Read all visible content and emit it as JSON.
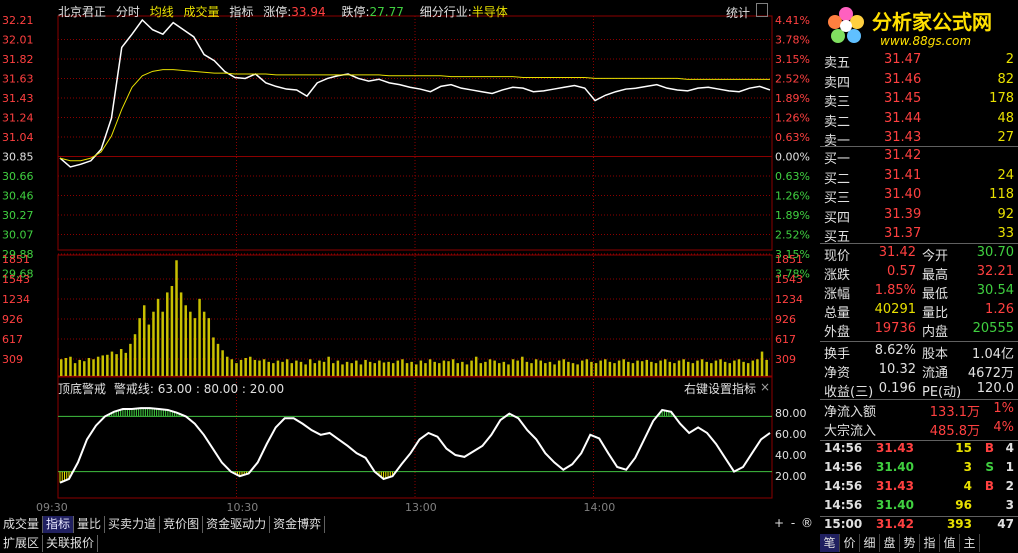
{
  "header": {
    "stock_name": "北京君正",
    "tab_time": "分时",
    "tab_avg": "均线",
    "tab_vol": "成交量",
    "tab_ind": "指标",
    "limit_up_label": "涨停:",
    "limit_up_value": "33.94",
    "limit_down_label": "跌停:",
    "limit_down_value": "27.77",
    "industry_label": "细分行业:",
    "industry_value": "半导体",
    "stat_button": "统计"
  },
  "axes": {
    "price_labels": [
      "32.21",
      "32.01",
      "31.82",
      "31.63",
      "31.43",
      "31.24",
      "31.04",
      "30.85",
      "30.66",
      "30.46",
      "30.27",
      "30.07",
      "29.88",
      "29.68"
    ],
    "pct_labels": [
      "4.41%",
      "3.78%",
      "3.15%",
      "2.52%",
      "1.89%",
      "1.26%",
      "0.63%",
      "0.00%",
      "0.63%",
      "1.26%",
      "1.89%",
      "2.52%",
      "3.15%",
      "3.78%"
    ],
    "vol_labels": [
      "1851",
      "1543",
      "1234",
      "926",
      "617",
      "309"
    ],
    "ind_labels": [
      "80.00",
      "60.00",
      "40.00",
      "20.00"
    ],
    "time_labels": [
      "09:30",
      "10:30",
      "13:00",
      "14:00"
    ]
  },
  "indicator": {
    "name": "顶底警戒",
    "param_text": "警戒线: 63.00 : 80.00 : 20.00",
    "right_text": "右键设置指标",
    "close": "×"
  },
  "chart_data": [
    {
      "type": "line",
      "name_price": "price",
      "ylim": [
        29.68,
        32.21
      ],
      "prev_close": 30.85,
      "price": [
        30.65,
        30.55,
        30.58,
        30.62,
        30.75,
        31.1,
        31.9,
        32.05,
        32.21,
        32.1,
        32.05,
        32.18,
        32.1,
        32.02,
        31.82,
        31.75,
        31.63,
        31.56,
        31.55,
        31.6,
        31.5,
        31.46,
        31.43,
        31.42,
        31.35,
        31.5,
        31.55,
        31.58,
        31.6,
        31.55,
        31.52,
        31.54,
        31.5,
        31.48,
        31.45,
        31.43,
        31.4,
        31.46,
        31.48,
        31.44,
        31.42,
        31.4,
        31.38,
        31.42,
        31.45,
        31.44,
        31.4,
        31.41,
        31.43,
        31.45,
        31.47,
        31.44,
        31.3,
        31.36,
        31.4,
        31.43,
        31.44,
        31.46,
        31.48,
        31.44,
        31.42,
        31.41,
        31.44,
        31.45,
        31.43,
        31.41,
        31.4,
        31.44,
        31.46,
        31.42
      ],
      "avg": [
        30.65,
        30.62,
        30.62,
        30.65,
        30.72,
        30.9,
        31.2,
        31.45,
        31.58,
        31.63,
        31.65,
        31.65,
        31.64,
        31.63,
        31.62,
        31.61,
        31.61,
        31.6,
        31.6,
        31.6,
        31.6,
        31.59,
        31.59,
        31.59,
        31.59,
        31.59,
        31.59,
        31.59,
        31.59,
        31.59,
        31.59,
        31.59,
        31.58,
        31.58,
        31.58,
        31.58,
        31.58,
        31.58,
        31.57,
        31.57,
        31.57,
        31.57,
        31.57,
        31.57,
        31.57,
        31.56,
        31.56,
        31.56,
        31.56,
        31.56,
        31.56,
        31.56,
        31.55,
        31.55,
        31.55,
        31.55,
        31.55,
        31.55,
        31.55,
        31.55,
        31.55,
        31.54,
        31.54,
        31.54,
        31.54,
        31.54,
        31.54,
        31.54,
        31.54,
        31.54
      ]
    },
    {
      "type": "bar",
      "ylim": [
        0,
        1851
      ],
      "values": [
        260,
        280,
        300,
        200,
        250,
        230,
        280,
        260,
        300,
        320,
        330,
        380,
        340,
        420,
        360,
        500,
        650,
        900,
        1100,
        800,
        1000,
        1200,
        1000,
        1300,
        1400,
        1800,
        1300,
        1100,
        1000,
        900,
        1200,
        1000,
        900,
        600,
        500,
        400,
        300,
        260,
        200,
        250,
        280,
        300,
        250,
        240,
        260,
        220,
        200,
        240,
        220,
        260,
        200,
        240,
        220,
        180,
        260,
        200,
        240,
        220,
        300,
        200,
        240,
        180,
        220,
        200,
        240,
        180,
        250,
        220,
        200,
        240,
        210,
        220,
        200,
        240,
        260,
        200,
        220,
        180,
        240,
        200,
        260,
        220,
        200,
        240,
        230,
        260,
        200,
        220,
        180,
        240,
        300,
        200,
        220,
        260,
        240,
        200,
        220,
        180,
        260,
        240,
        300,
        220,
        200,
        260,
        240,
        200,
        220,
        180,
        240,
        260,
        220,
        200,
        180,
        240,
        260,
        220,
        200,
        240,
        260,
        220,
        200,
        240,
        260,
        220,
        200,
        240,
        230,
        250,
        220,
        200,
        240,
        260,
        220,
        200,
        240,
        260,
        220,
        200,
        240,
        260,
        220,
        200,
        240,
        260,
        220,
        200,
        240,
        260,
        220,
        200,
        240,
        260,
        380,
        250
      ]
    },
    {
      "type": "line",
      "name_ind": "顶底警戒",
      "ylim": [
        0,
        100
      ],
      "lines": [
        80,
        20
      ],
      "values": [
        8,
        12,
        30,
        55,
        70,
        80,
        85,
        88,
        88,
        89,
        89,
        88,
        87,
        84,
        80,
        72,
        60,
        45,
        30,
        20,
        15,
        18,
        30,
        50,
        68,
        78,
        78,
        72,
        65,
        60,
        62,
        55,
        48,
        40,
        35,
        20,
        12,
        15,
        28,
        40,
        55,
        62,
        58,
        45,
        38,
        36,
        42,
        48,
        60,
        76,
        83,
        78,
        65,
        55,
        40,
        30,
        22,
        28,
        40,
        60,
        56,
        40,
        25,
        22,
        35,
        55,
        75,
        87,
        85,
        72,
        62,
        68,
        62,
        50,
        35,
        20,
        25,
        40,
        55,
        62
      ]
    }
  ],
  "order_book": {
    "sell": [
      {
        "label": "卖五",
        "price": "31.47",
        "vol": "2"
      },
      {
        "label": "卖四",
        "price": "31.46",
        "vol": "82"
      },
      {
        "label": "卖三",
        "price": "31.45",
        "vol": "178"
      },
      {
        "label": "卖二",
        "price": "31.44",
        "vol": "48"
      },
      {
        "label": "卖一",
        "price": "31.43",
        "vol": "27"
      }
    ],
    "buy": [
      {
        "label": "买一",
        "price": "31.42",
        "vol": ""
      },
      {
        "label": "买二",
        "price": "31.41",
        "vol": "24"
      },
      {
        "label": "买三",
        "price": "31.40",
        "vol": "118"
      },
      {
        "label": "买四",
        "price": "31.39",
        "vol": "92"
      },
      {
        "label": "买五",
        "price": "31.37",
        "vol": "33"
      }
    ]
  },
  "quote": {
    "now_label": "现价",
    "now": "31.42",
    "open_label": "今开",
    "open": "30.70",
    "chg_label": "涨跌",
    "chg": "0.57",
    "high_label": "最高",
    "high": "32.21",
    "pct_label": "涨幅",
    "pct": "1.85%",
    "low_label": "最低",
    "low": "30.54",
    "vol_label": "总量",
    "vol": "40291",
    "vr_label": "量比",
    "vr": "1.26",
    "out_label": "外盘",
    "out": "19736",
    "in_label": "内盘",
    "in": "20555",
    "turn_label": "换手",
    "turn": "8.62%",
    "cap_label": "股本",
    "cap": "1.04亿",
    "nav_label": "净资",
    "nav": "10.32",
    "float_label": "流通",
    "float": "4672万",
    "eps_label": "收益(三)",
    "eps": "0.196",
    "pe_label": "PE(动)",
    "pe": "120.0",
    "net_label": "净流入额",
    "net": "133.1万",
    "net_pct": "1%",
    "big_label": "大宗流入",
    "big": "485.8万",
    "big_pct": "4%"
  },
  "ticks": [
    {
      "time": "14:56",
      "price": "31.43",
      "vol": "15",
      "side": "B",
      "num": "4"
    },
    {
      "time": "14:56",
      "price": "31.40",
      "vol": "3",
      "side": "S",
      "num": "1"
    },
    {
      "time": "14:56",
      "price": "31.43",
      "vol": "4",
      "side": "B",
      "num": "2"
    },
    {
      "time": "14:56",
      "price": "31.40",
      "vol": "96",
      "side": "",
      "num": "3"
    },
    {
      "time": "15:00",
      "price": "31.42",
      "vol": "393",
      "side": "",
      "num": "47"
    }
  ],
  "bottom_tabs": [
    "成交量",
    "指标",
    "量比",
    "买卖力道",
    "竞价图",
    "资金驱动力",
    "资金博弈"
  ],
  "bottom_tabs2": [
    "扩展区",
    "关联报价"
  ],
  "zoom_buttons": [
    "+",
    "-",
    "®"
  ],
  "right_tabs": [
    "笔",
    "价",
    "细",
    "盘",
    "势",
    "指",
    "值",
    "主"
  ],
  "logo": {
    "title": "分析家公式网",
    "url": "www.88gs.com"
  },
  "colors": {
    "up": "#ff4040",
    "down": "#40d040",
    "neutral": "#e0e0e0",
    "avg": "#e8e000",
    "grid": "#8b0000",
    "vol": "#c8c000"
  }
}
